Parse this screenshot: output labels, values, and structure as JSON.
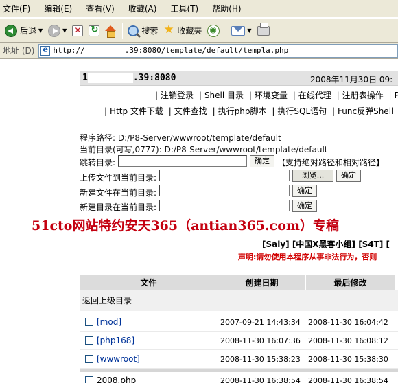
{
  "browser": {
    "menu": [
      {
        "label": "文件",
        "key": "(F)"
      },
      {
        "label": "编辑",
        "key": "(E)"
      },
      {
        "label": "查看",
        "key": "(V)"
      },
      {
        "label": "收藏",
        "key": "(A)"
      },
      {
        "label": "工具",
        "key": "(T)"
      },
      {
        "label": "帮助",
        "key": "(H)"
      }
    ],
    "toolbar": {
      "back_label": "后退",
      "search_label": "搜索",
      "favorites_label": "收藏夹"
    },
    "address": {
      "label": "地址 (D)",
      "url_prefix": "http://",
      "url_rest": ".39:8080/template/default/templa.php"
    }
  },
  "page": {
    "header": {
      "host_prefix": "1",
      "host_suffix": ".39:8080",
      "date": "2008年11月30日 09:"
    },
    "nav_row1": [
      "注销登录",
      "Shell 目录",
      "环境变量",
      "在线代理",
      "注册表操作",
      "PH"
    ],
    "nav_row2": [
      "Http 文件下载",
      "文件查找",
      "执行php脚本",
      "执行SQL语句",
      "Func反弹Shell"
    ],
    "info": {
      "program_path": "程序路径: D:/P8-Server/wwwroot/template/default",
      "current_dir": "当前目录(可写,0777): D:/P8-Server/wwwroot/template/default"
    },
    "forms": {
      "jump_label": "跳转目录:",
      "confirm": "确定",
      "jump_hint": "【支持绝对路径和相对路径】",
      "upload_label": "上传文件到当前目录:",
      "browse": "浏览...",
      "new_file_label": "新建文件在当前目录:",
      "new_dir_label": "新建目录在当前目录:"
    },
    "watermark": "51cto网站特约安天365（antian365.com）专稿",
    "links_line": "[Saiy] [中国X黑客小组] [S4T] [",
    "notice": "声明:请勿使用本程序从事非法行为，否则",
    "table": {
      "headers": [
        "文件",
        "创建日期",
        "最后修改"
      ],
      "parent_dir": "返回上级目录",
      "rows": [
        {
          "name": "[mod]",
          "created": "2007-09-21 14:43:34",
          "modified": "2008-11-30 16:04:42"
        },
        {
          "name": "[php168]",
          "created": "2008-11-30 16:07:36",
          "modified": "2008-11-30 16:08:12"
        },
        {
          "name": "[wwwroot]",
          "created": "2008-11-30 15:38:23",
          "modified": "2008-11-30 15:38:30"
        },
        {
          "name": "2008.php",
          "created": "2008-11-30 16:38:54",
          "modified": "2008-11-30 16:38:54"
        }
      ]
    }
  }
}
